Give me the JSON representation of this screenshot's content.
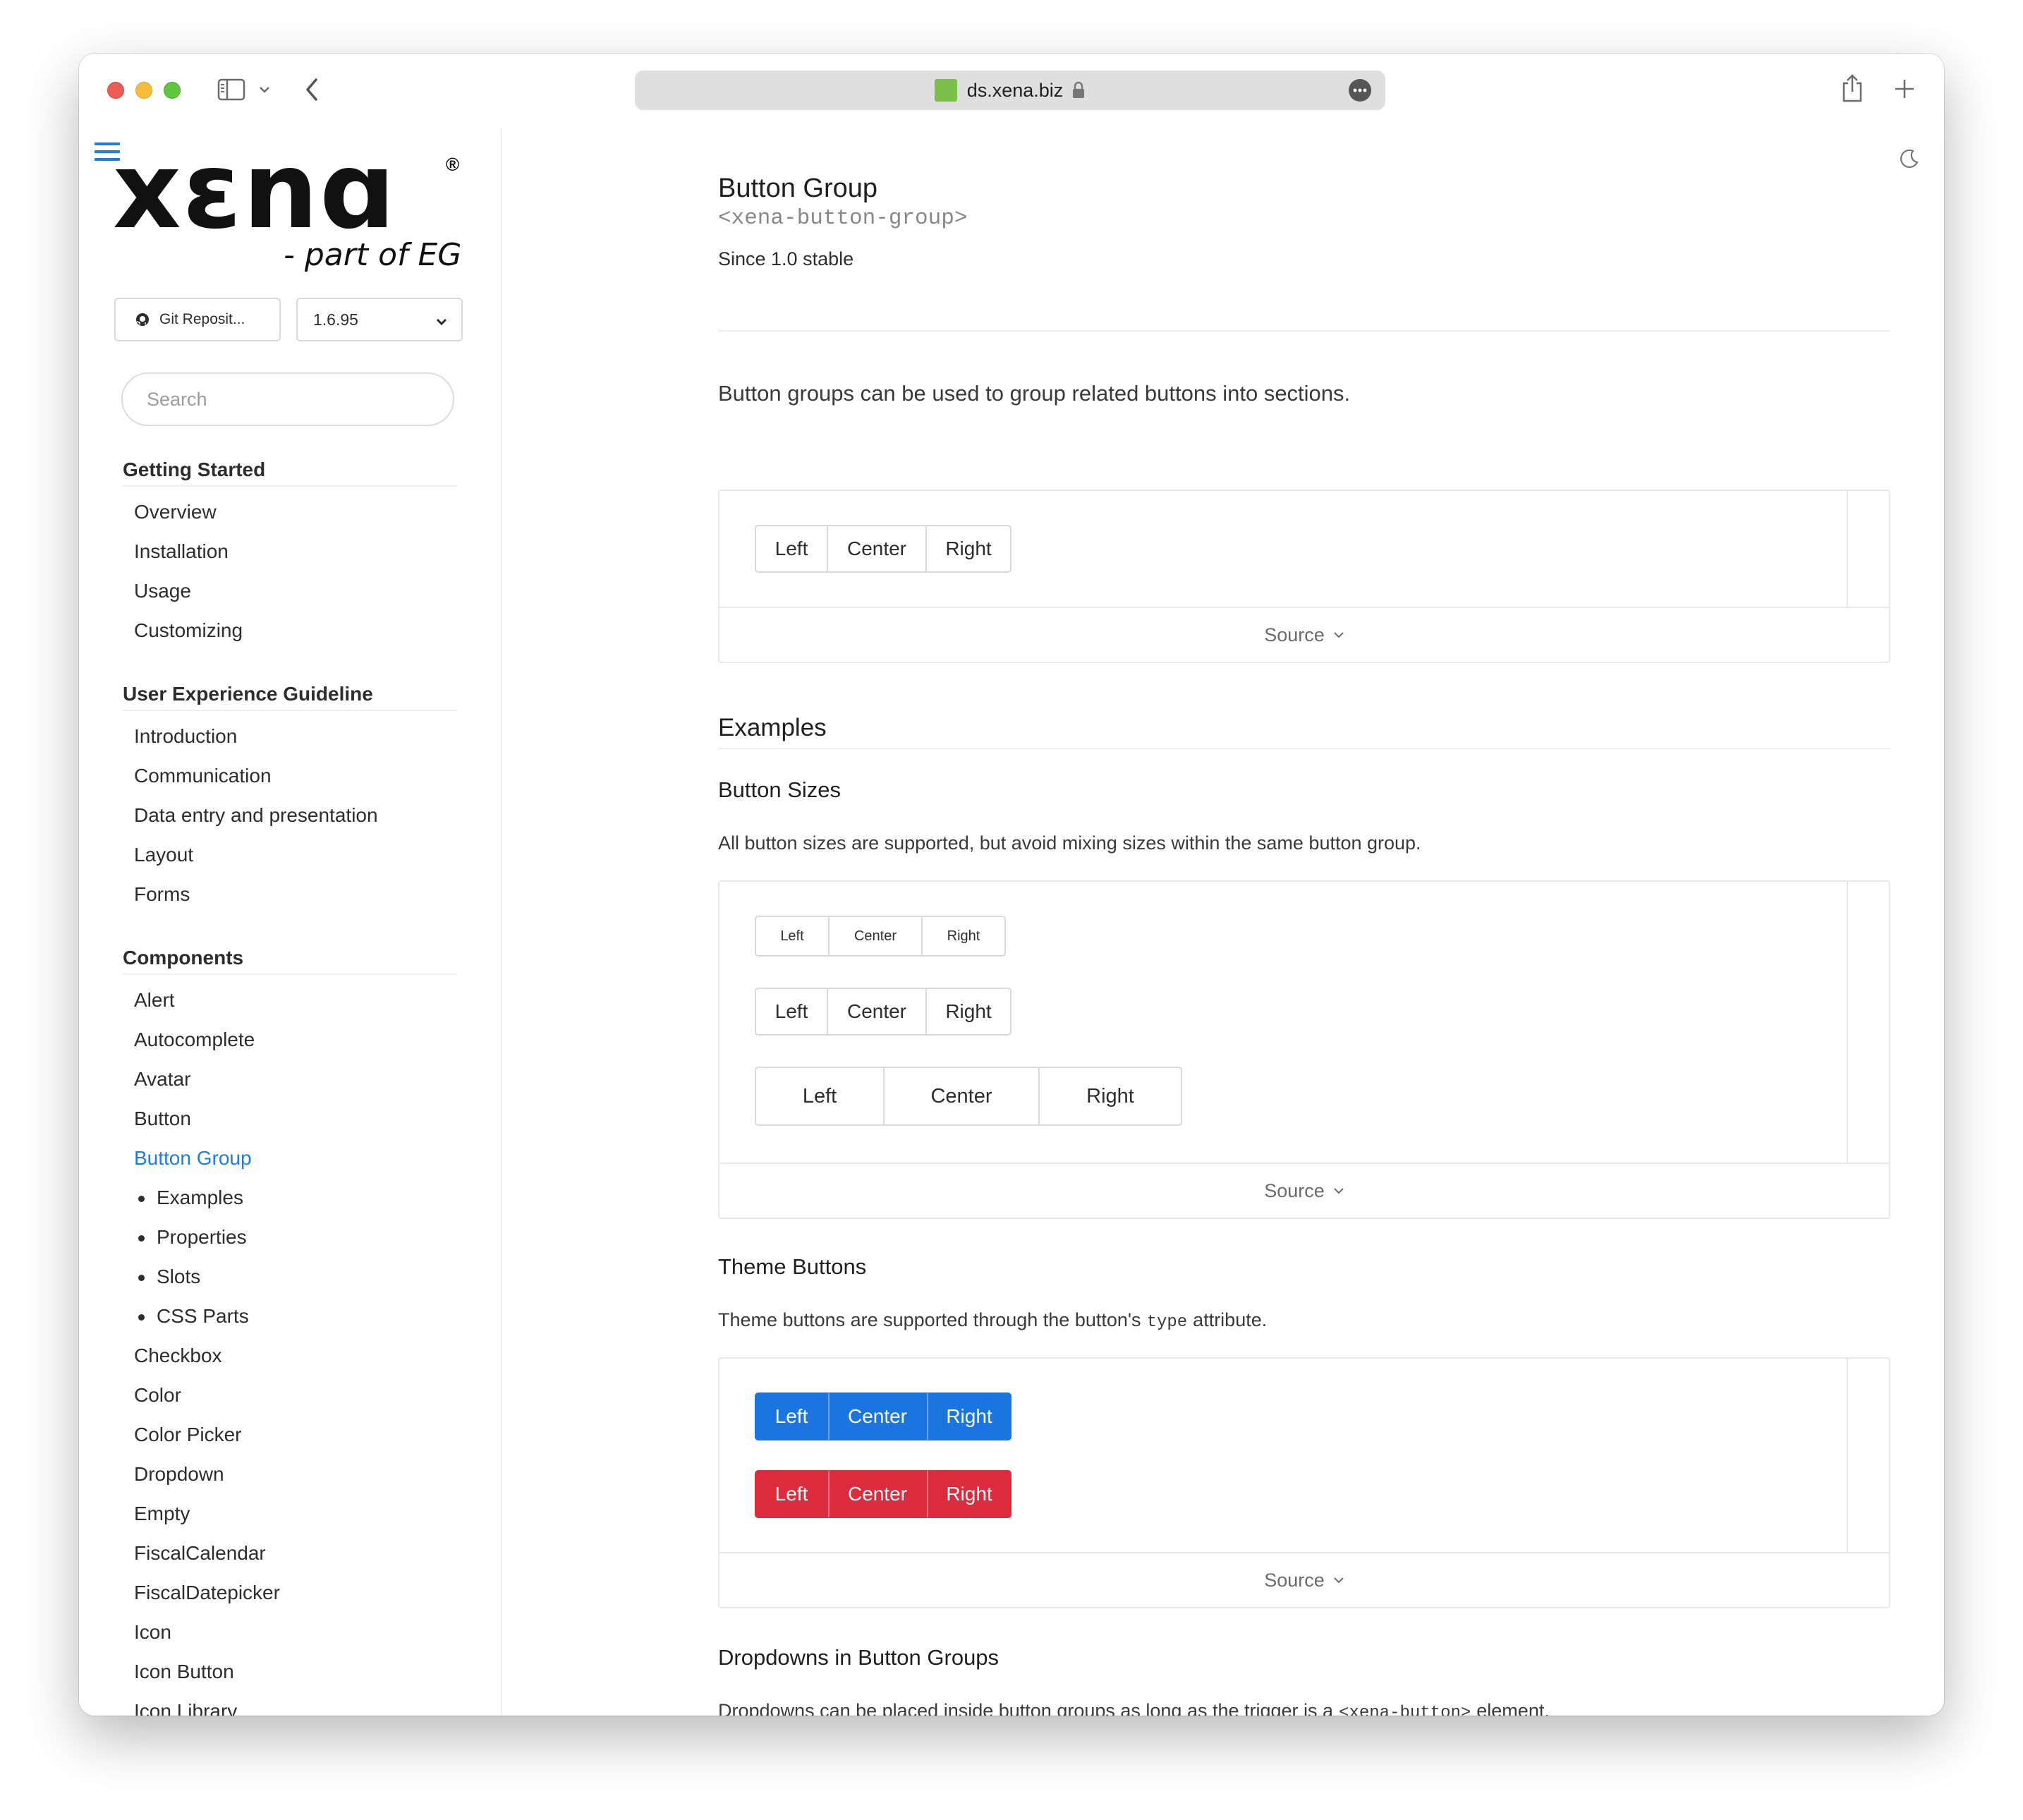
{
  "browser": {
    "url": "ds.xena.biz",
    "colors": {
      "close": "#ee5b55",
      "minimize": "#f5bd3a",
      "zoom": "#5fc63f"
    },
    "icons": [
      "sidebar-toggle-icon",
      "chevron-down-icon",
      "back-icon",
      "lock-icon",
      "more-icon",
      "share-icon",
      "plus-icon"
    ]
  },
  "sidebar": {
    "logo_word": "xɛnɑ",
    "logo_reg": "®",
    "logo_tagline": "- part of EG",
    "repo_button": "Git Reposit...",
    "version": "1.6.95",
    "search_placeholder": "Search",
    "sections": [
      {
        "heading": "Getting Started",
        "items": [
          "Overview",
          "Installation",
          "Usage",
          "Customizing"
        ]
      },
      {
        "heading": "User Experience Guideline",
        "items": [
          "Introduction",
          "Communication",
          "Data entry and presentation",
          "Layout",
          "Forms"
        ]
      },
      {
        "heading": "Components",
        "items": [
          "Alert",
          "Autocomplete",
          "Avatar",
          "Button",
          "Button Group"
        ],
        "active_sub_items": [
          "Examples",
          "Properties",
          "Slots",
          "CSS Parts"
        ],
        "items_after": [
          "Checkbox",
          "Color",
          "Color Picker",
          "Dropdown",
          "Empty",
          "FiscalCalendar",
          "FiscalDatepicker",
          "Icon",
          "Icon Button",
          "Icon Library"
        ]
      }
    ],
    "accent_color": "#1f7de0"
  },
  "page": {
    "title": "Button Group",
    "tag": "<xena-button-group>",
    "since": "Since 1.0 stable",
    "lead": "Button groups can be used to group related buttons into sections.",
    "source_label": "Source",
    "examples_heading": "Examples",
    "sizes": {
      "heading": "Button Sizes",
      "text": "All button sizes are supported, but avoid mixing sizes within the same button group."
    },
    "theme": {
      "heading": "Theme Buttons",
      "text_before": "Theme buttons are supported through the button's",
      "code": "type",
      "text_after": "attribute.",
      "primary_color": "#1a75e0",
      "danger_color": "#dc2b3d"
    },
    "dropdowns": {
      "heading": "Dropdowns in Button Groups",
      "text_before": "Dropdowns can be placed inside button groups as long as the trigger is a",
      "code": "<xena-button>",
      "text_after": "element."
    },
    "buttons": {
      "left": "Left",
      "center": "Center",
      "right": "Right"
    }
  }
}
